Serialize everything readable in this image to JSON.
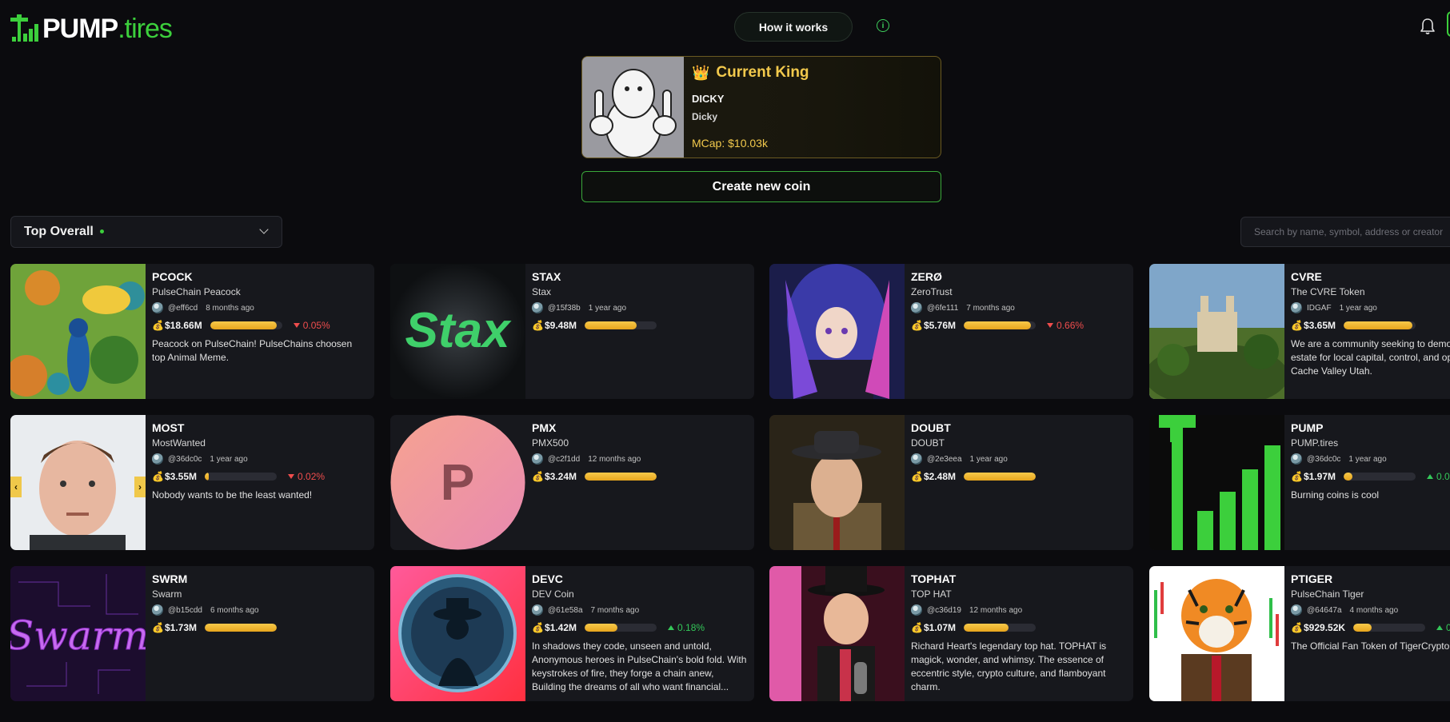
{
  "header": {
    "logo_brand": "PUMP",
    "logo_suffix": ".tires",
    "how_it_works": "How it works"
  },
  "king": {
    "title": "Current King",
    "symbol": "DICKY",
    "name": "Dicky",
    "mcap": "MCap: $10.03k"
  },
  "create_coin": "Create new coin",
  "controls": {
    "sort_label": "Top Overall",
    "search_placeholder": "Search by name, symbol, address or creator..."
  },
  "coins": [
    {
      "symbol": "PCOCK",
      "name": "PulseChain Peacock",
      "creator": "@eff6cd",
      "age": "8 months ago",
      "mcap": "$18.66M",
      "progress": 0.92,
      "change": "0.05%",
      "dir": "down",
      "desc": "Peacock on PulseChain! PulseChains choosen top Animal Meme."
    },
    {
      "symbol": "STAX",
      "name": "Stax",
      "creator": "@15f38b",
      "age": "1 year ago",
      "mcap": "$9.48M",
      "progress": 0.72,
      "change": "",
      "dir": "",
      "desc": ""
    },
    {
      "symbol": "ZERØ",
      "name": "ZeroTrust",
      "creator": "@6fe111",
      "age": "7 months ago",
      "mcap": "$5.76M",
      "progress": 0.93,
      "change": "0.66%",
      "dir": "down",
      "desc": ""
    },
    {
      "symbol": "CVRE",
      "name": "The CVRE Token",
      "creator": "IDGAF",
      "age": "1 year ago",
      "mcap": "$3.65M",
      "progress": 0.95,
      "change": "",
      "dir": "",
      "desc": "We are a community seeking to democratize real estate for local capital, control, and opportunity in Cache Valley Utah."
    },
    {
      "symbol": "MOST",
      "name": "MostWanted",
      "creator": "@36dc0c",
      "age": "1 year ago",
      "mcap": "$3.55M",
      "progress": 0.06,
      "change": "0.02%",
      "dir": "down",
      "desc": "Nobody wants to be the least wanted!"
    },
    {
      "symbol": "PMX",
      "name": "PMX500",
      "creator": "@c2f1dd",
      "age": "12 months ago",
      "mcap": "$3.24M",
      "progress": 1.0,
      "change": "",
      "dir": "",
      "desc": ""
    },
    {
      "symbol": "DOUBT",
      "name": "DOUBT",
      "creator": "@2e3eea",
      "age": "1 year ago",
      "mcap": "$2.48M",
      "progress": 1.0,
      "change": "",
      "dir": "",
      "desc": ""
    },
    {
      "symbol": "PUMP",
      "name": "PUMP.tires",
      "creator": "@36dc0c",
      "age": "1 year ago",
      "mcap": "$1.97M",
      "progress": 0.12,
      "change": "0.0",
      "dir": "up",
      "desc": "Burning coins is cool"
    },
    {
      "symbol": "SWRM",
      "name": "Swarm",
      "creator": "@b15cdd",
      "age": "6 months ago",
      "mcap": "$1.73M",
      "progress": 1.0,
      "change": "",
      "dir": "",
      "desc": ""
    },
    {
      "symbol": "DEVC",
      "name": "DEV Coin",
      "creator": "@61e58a",
      "age": "7 months ago",
      "mcap": "$1.42M",
      "progress": 0.45,
      "change": "0.18%",
      "dir": "up",
      "desc": "In shadows they code, unseen and untold, Anonymous heroes in PulseChain's bold fold. With keystrokes of fire, they forge a chain anew, Building the dreams of all who want financial..."
    },
    {
      "symbol": "TOPHAT",
      "name": "TOP HAT",
      "creator": "@c36d19",
      "age": "12 months ago",
      "mcap": "$1.07M",
      "progress": 0.62,
      "change": "",
      "dir": "",
      "desc": "Richard Heart's legendary top hat. TOPHAT is magick, wonder, and whimsy. The essence of eccentric style, crypto culture, and flamboyant charm."
    },
    {
      "symbol": "PTIGER",
      "name": "PulseChain Tiger",
      "creator": "@64647a",
      "age": "4 months ago",
      "mcap": "$929.52K",
      "progress": 0.25,
      "change": "0",
      "dir": "up",
      "desc": "The Official Fan Token of TigerCryptoC..."
    }
  ],
  "icons": {
    "money_bag": "💰",
    "crown": "👑"
  }
}
